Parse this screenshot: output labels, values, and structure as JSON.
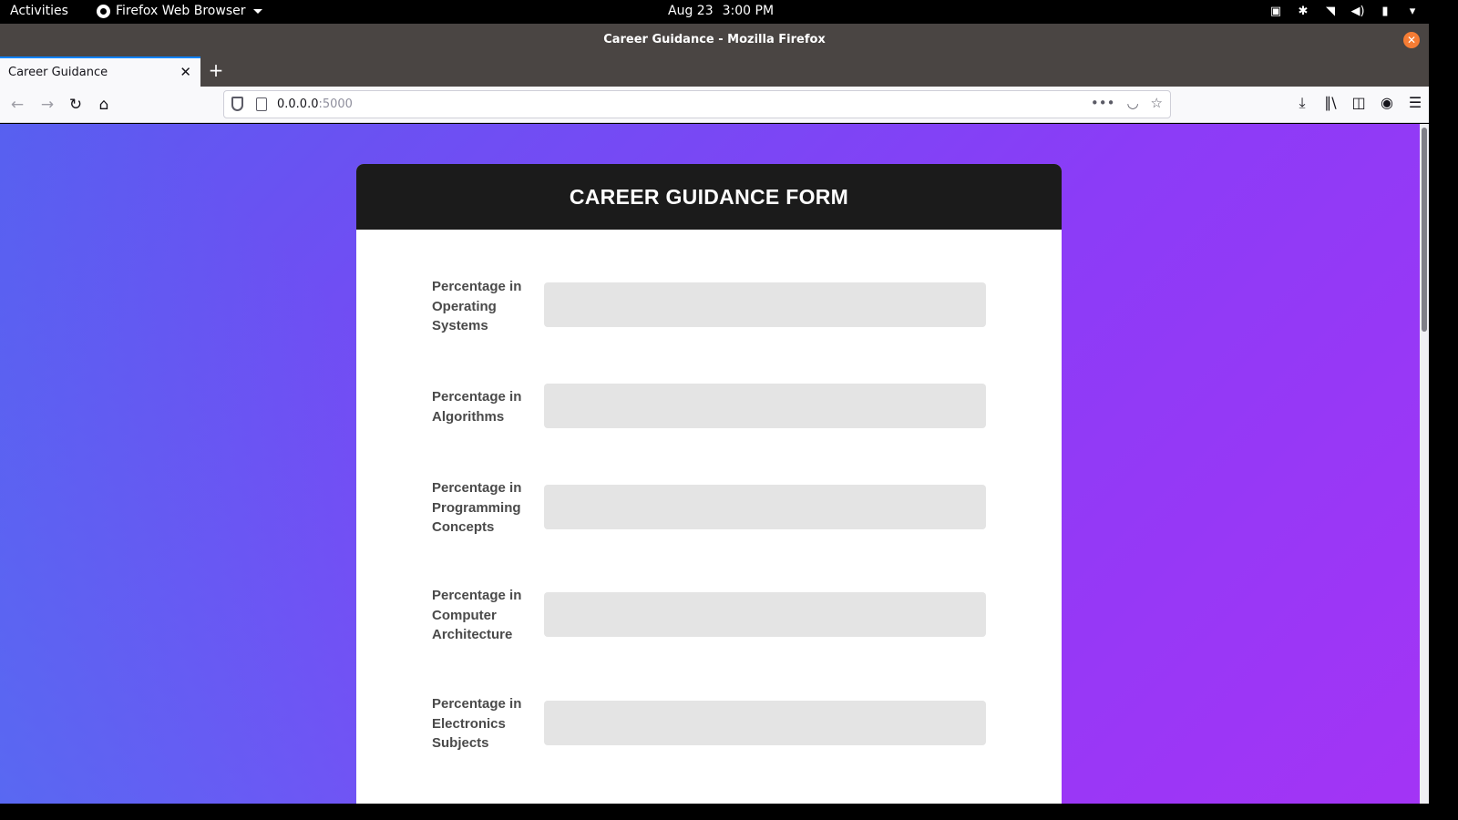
{
  "system_bar": {
    "activities": "Activities",
    "app_name": "Firefox Web Browser",
    "date": "Aug 23",
    "time": "3:00 PM"
  },
  "window": {
    "title": "Career Guidance - Mozilla Firefox"
  },
  "tabs": [
    {
      "label": "Career Guidance",
      "active": true
    }
  ],
  "navigation": {
    "url_host": "0.0.0.0",
    "url_port": ":5000"
  },
  "form": {
    "heading": "CAREER GUIDANCE FORM",
    "fields": [
      {
        "label": "Percentage in Operating Systems",
        "value": ""
      },
      {
        "label": "Percentage in Algorithms",
        "value": ""
      },
      {
        "label": "Percentage in Programming Concepts",
        "value": ""
      },
      {
        "label": "Percentage in Computer Architecture",
        "value": ""
      },
      {
        "label": "Percentage in Electronics Subjects",
        "value": ""
      }
    ]
  }
}
